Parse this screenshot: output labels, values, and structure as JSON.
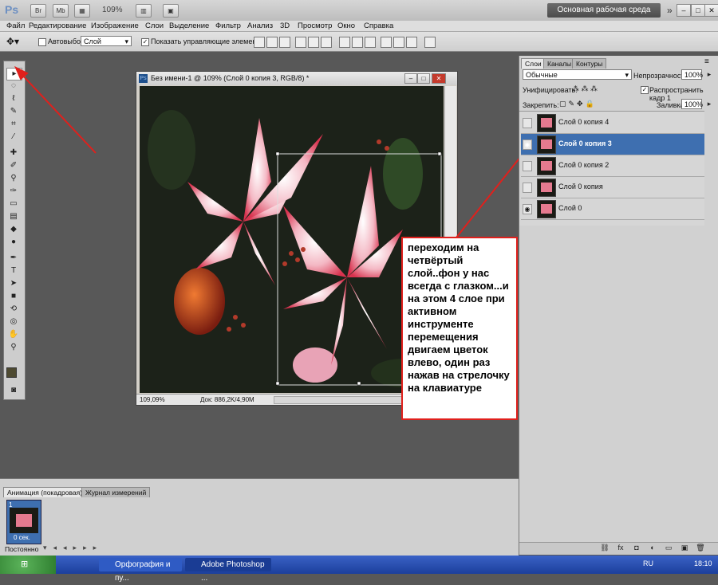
{
  "app": {
    "name": "Ps",
    "zoom": "109%",
    "workspace": "Основная рабочая среда",
    "window_buttons": [
      "–",
      "□",
      "✕"
    ],
    "top_icons": [
      "Br",
      "Mb"
    ]
  },
  "menu": [
    "Файл",
    "Редактирование",
    "Изображение",
    "Слои",
    "Выделение",
    "Фильтр",
    "Анализ",
    "3D",
    "Просмотр",
    "Окно",
    "Справка"
  ],
  "options_bar": {
    "autoselect_label": "Автовыбор:",
    "autoselect_value": "Слой",
    "show_controls_label": "Показать управляющие элементы"
  },
  "document": {
    "title": "Без имени-1 @ 109% (Слой 0 копия 3, RGB/8) *",
    "zoom": "109,09%",
    "doc_size": "Док: 886,2K/4,90M"
  },
  "annotation": "переходим на четвёртый слой..фон у нас всегда с глазком...и на этом 4 слое при активном инструменте перемещения двигаем цветок влево, один раз нажав на стрелочку на клавиатуре",
  "layers_panel": {
    "tabs": [
      "Слои",
      "Каналы",
      "Контуры"
    ],
    "blend_mode": "Обычные",
    "opacity_label": "Непрозрачность:",
    "opacity": "100%",
    "unify_label": "Унифицировать:",
    "propagate_label": "Распространить кадр 1",
    "lock_label": "Закрепить:",
    "fill_label": "Заливка:",
    "fill": "100%",
    "layers": [
      {
        "name": "Слой 0 копия 4",
        "visible": false,
        "selected": false
      },
      {
        "name": "Слой 0 копия 3",
        "visible": true,
        "selected": true
      },
      {
        "name": "Слой 0 копия 2",
        "visible": false,
        "selected": false
      },
      {
        "name": "Слой 0 копия",
        "visible": false,
        "selected": false
      },
      {
        "name": "Слой 0",
        "visible": true,
        "selected": false
      }
    ]
  },
  "animation_panel": {
    "tabs": [
      "Анимация (покадровая)",
      "Журнал измерений"
    ],
    "frame_number": "1",
    "frame_time": "0 сек.",
    "loop": "Постоянно"
  },
  "taskbar": {
    "start": "",
    "tasks": [
      "Орфография и пу...",
      "Adobe Photoshop ..."
    ],
    "lang": "RU",
    "time": "18:10"
  },
  "colors": {
    "accent": "#3e6fb0",
    "annotation_border": "#e0201c",
    "arrow": "#e0201c"
  }
}
